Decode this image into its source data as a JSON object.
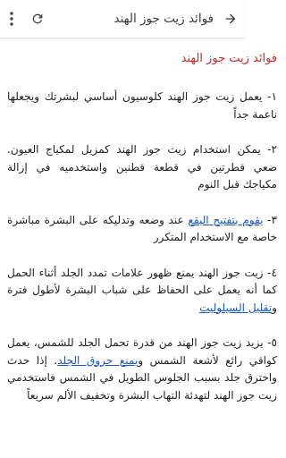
{
  "appbar": {
    "title": "فوائد زيت جوز الهند",
    "menu_icon": "more-vert-icon",
    "refresh_icon": "refresh-icon",
    "back_icon": "arrow-forward-icon"
  },
  "article": {
    "heading": "فوائد زيت جوز الهند",
    "p1": "١- يعمل زيت جوز الهند كلوسيون أساسي لبشرتك ويجعلها ناعمة جداً",
    "p2": "٢- يمكن استخدام زيت جوز الهند كمزيل لمكياج العيون. ضعي قطرتين في قطعة قطنين واستخدميه في إزالة مكياجك قبل النوم",
    "p3": {
      "prefix": "٣- ",
      "link": "يقوم بتفتيح البقع",
      "rest": " عند وضعه وتدليكه على البشرة مباشرة خاصة مع الاستخدام المتكرر"
    },
    "p4": {
      "text": "٤- زيت جوز الهند يمنع ظهور علامات تمدد الجلد أثناء الحمل كما أنه يعمل على الحفاظ على شباب البشرة لأطول فترة ",
      "connector": "و",
      "link": "تقليل السيلوليت"
    },
    "p5": {
      "text1": "٥- يزيد زيت جوز الهند من قدرة تحمل الجلد للشمس، يعمل كواقي رائع لأشعة الشمس و",
      "link": "يمنع حروق الجلد",
      "text2": ". إذا حدث واحترق جلد بسبب الجلوس الطويل في الشمس فاستخدمي زيت جوز الهند لتهدئة التهاب البشرة وتخفيف الألم سريعاً"
    },
    "colors": {
      "heading": "#d0261f",
      "link": "#1a56c9",
      "text": "#1f1f1f"
    }
  }
}
